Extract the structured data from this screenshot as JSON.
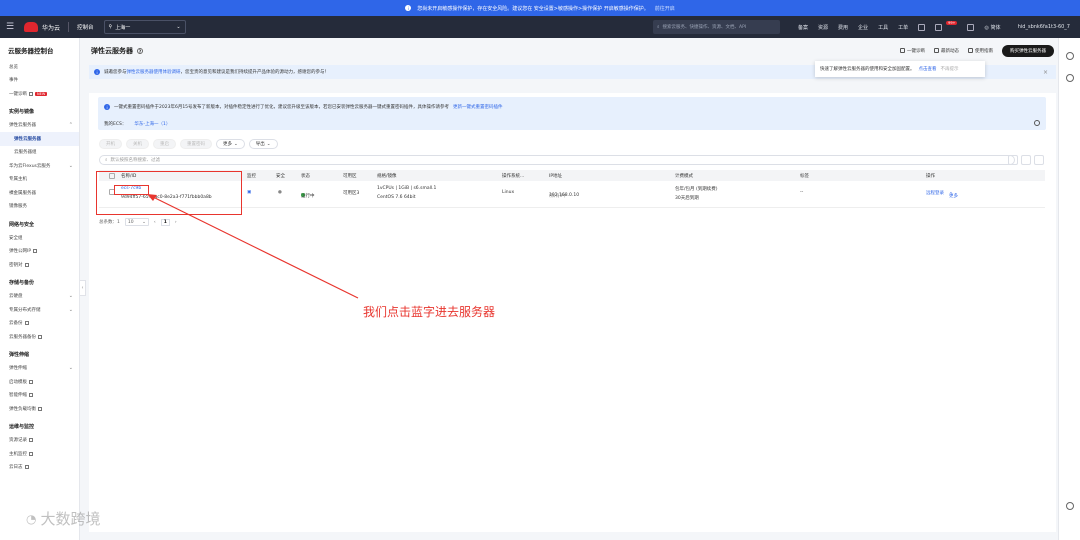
{
  "notice": {
    "text": "您尚未开启敏感操作保护，存在安全风险。建议您在 安全设置>敏感操作>操作保护 开启敏感操作保护。",
    "link": "前往开启"
  },
  "topbar": {
    "brand": "华为云",
    "console": "控制台",
    "region": "上海一",
    "search_placeholder": "搜索云服务、快捷操作、资源、文档、API",
    "nav": [
      "备案",
      "资源",
      "费用",
      "企业",
      "工具",
      "工单"
    ],
    "badge": "99+",
    "lang": "简体",
    "user": "hid_sbnk6fa1t3-60_7"
  },
  "sidebar": {
    "title": "云服务器控制台",
    "items": [
      {
        "label": "总览"
      },
      {
        "label": "事件"
      },
      {
        "label": "一键诊断",
        "tag": "NEW"
      }
    ],
    "groups": [
      {
        "title": "实例与镜像",
        "items": [
          {
            "label": "弹性云服务器",
            "chev": "^"
          },
          {
            "label": "弹性云服务器",
            "sub": true,
            "active": true
          },
          {
            "label": "云服务器组",
            "sub": true
          },
          {
            "label": "华为云Flexus云服务",
            "chev": "v"
          },
          {
            "label": "专属主机"
          },
          {
            "label": "裸金属服务器"
          },
          {
            "label": "镜像服务"
          }
        ]
      },
      {
        "title": "网络与安全",
        "items": [
          {
            "label": "安全组"
          },
          {
            "label": "弹性公网IP"
          },
          {
            "label": "密钥对"
          }
        ]
      },
      {
        "title": "存储与备份",
        "items": [
          {
            "label": "云硬盘",
            "chev": "v"
          },
          {
            "label": "专属分布式存储",
            "chev": "v"
          },
          {
            "label": "云备份"
          },
          {
            "label": "云服务器备份"
          }
        ]
      },
      {
        "title": "弹性伸缩",
        "items": [
          {
            "label": "弹性伸缩",
            "chev": "v"
          },
          {
            "label": "启动模板"
          },
          {
            "label": "智能伸缩"
          },
          {
            "label": "弹性负载均衡"
          }
        ]
      },
      {
        "title": "运维与监控",
        "items": [
          {
            "label": "资源记录"
          },
          {
            "label": "主机监控"
          },
          {
            "label": "云日志"
          }
        ]
      }
    ]
  },
  "main": {
    "title": "弹性云服务器",
    "header_actions": [
      "一键诊断",
      "最新动态",
      "使用指南"
    ],
    "buy_label": "购买弹性云服务器",
    "tip_text": "快速了解弹性云服务器的使用和安全加固配置。",
    "tip_link": "点击查看",
    "tip_dismiss": "不再提示",
    "banner_pre": "诚邀您参与",
    "banner_link": "弹性云服务器使用体验调研",
    "banner_post": "，您宝贵的意见和建议是我们持续提升产品体验的源动力，感谢您的参与！",
    "notice_text": "一键式重置密码插件于2023年6月15号发布了新版本，对插件稳定性进行了优化，建议您升级至该版本，若您已安装弹性云服务器一键式重置密码插件，具体操作请参考",
    "notice_link": "更新一键式重置密码插件",
    "ecs_label": "我的ECS：",
    "ecs_region": "华东-上海一（1）",
    "buttons": [
      "开机",
      "关机",
      "重启",
      "重置密码",
      "更多",
      "导出"
    ],
    "filter_placeholder": "默认按照名称搜索、过滤",
    "columns": [
      "名称/ID",
      "监控",
      "安全",
      "状态",
      "可用区",
      "规格/镜像",
      "操作系统...",
      "IP地址",
      "计费模式",
      "标签",
      "操作"
    ],
    "row": {
      "name": "ecs-7c9b",
      "id": "9d94ff57-65...-ac0-8e2a3-f771fbbb0a8b",
      "status": "运行中",
      "zone": "可用区3",
      "spec1": "1vCPUs | 1GiB | s6.small.1",
      "spec2": "CentOS 7.6 64bit",
      "os": "Linux",
      "ip": "192.168.0.10",
      "ip_type": "(私有IP)",
      "billing1": "包年/包月 (到期续费)",
      "billing2": "30天后到期",
      "tag": "--",
      "op1": "远程登录",
      "op2": "更多"
    },
    "pager": {
      "total": "总条数：1",
      "size": "10",
      "page": "1"
    }
  },
  "annotation": "我们点击蓝字进去服务器",
  "watermark": "大数跨境"
}
